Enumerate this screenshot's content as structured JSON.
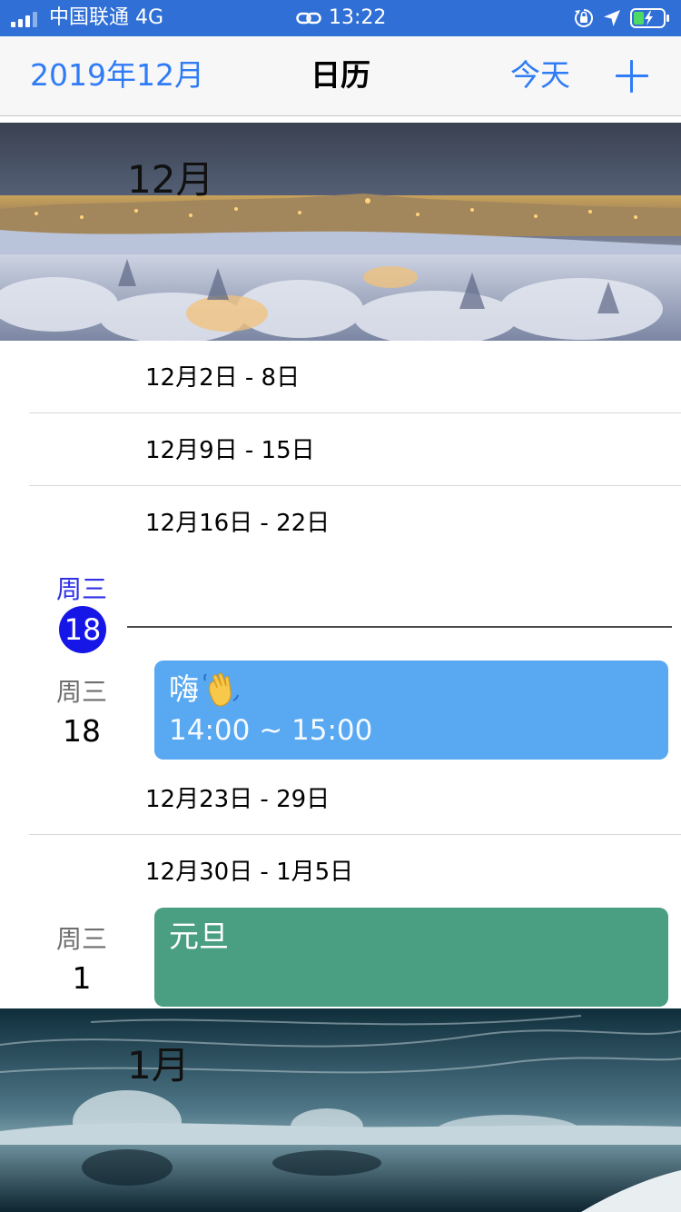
{
  "status_bar": {
    "carrier": "中国联通 4G",
    "time": "13:22",
    "icons": [
      "signal-icon",
      "link-icon",
      "orientation-lock-icon",
      "location-icon",
      "battery-icon"
    ]
  },
  "nav": {
    "month_button": "2019年12月",
    "title": "日历",
    "today_button": "今天",
    "add_icon": "plus-icon",
    "accent_color": "#2f7cf6"
  },
  "months": [
    {
      "label": "12月"
    },
    {
      "label": "1月"
    }
  ],
  "weeks": [
    "12月2日 - 8日",
    "12月9日 - 15日",
    "12月16日 - 22日",
    "12月23日 - 29日",
    "12月30日 - 1月5日"
  ],
  "today": {
    "weekday": "周三",
    "day": "18",
    "color": "#1616e6"
  },
  "days": [
    {
      "weekday": "周三",
      "day": "18"
    },
    {
      "weekday": "周三",
      "day": "1"
    }
  ],
  "events": [
    {
      "title": "嗨",
      "emoji_icon": "waving-hand-icon",
      "time": "14:00 ~ 15:00",
      "color": "#58a8f2"
    },
    {
      "title": "元旦",
      "color": "#4a9e82"
    }
  ]
}
